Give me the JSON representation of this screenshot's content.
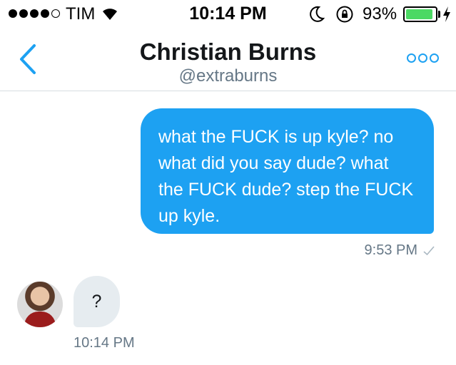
{
  "status_bar": {
    "carrier": "TIM",
    "time": "10:14 PM",
    "battery_percent": "93%",
    "battery_level": 0.93,
    "signal_bars_filled": 4,
    "signal_bars_total": 5,
    "icons": [
      "wifi-icon",
      "moon-icon",
      "rotation-lock-icon",
      "battery-icon",
      "charging-bolt-icon"
    ]
  },
  "header": {
    "name": "Christian Burns",
    "handle": "@extraburns",
    "back_icon": "chevron-left-icon",
    "more_icon": "more-options-icon"
  },
  "messages": [
    {
      "direction": "outgoing",
      "text": "what the FUCK is up kyle? no what did you say dude? what the FUCK dude? step the FUCK up kyle.",
      "time": "9:53 PM",
      "status_icon": "sent-check-icon"
    },
    {
      "direction": "incoming",
      "text": "?",
      "time": "10:14 PM"
    }
  ],
  "colors": {
    "accent": "#1da1f2",
    "incoming_bubble": "#e6ecf0",
    "secondary_text": "#657786",
    "battery": "#4cd964"
  }
}
